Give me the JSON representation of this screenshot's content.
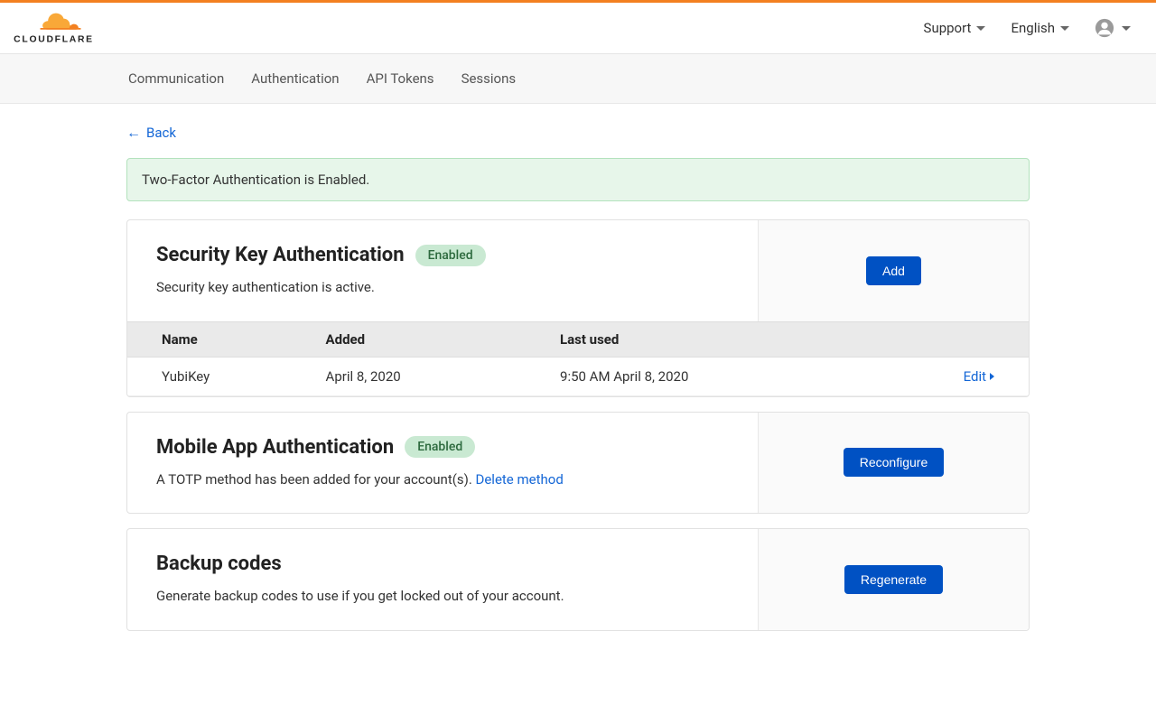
{
  "header": {
    "support_label": "Support",
    "language_label": "English"
  },
  "tabs": [
    {
      "label": "Communication"
    },
    {
      "label": "Authentication"
    },
    {
      "label": "API Tokens"
    },
    {
      "label": "Sessions"
    }
  ],
  "back_label": "Back",
  "alert": {
    "text": "Two-Factor Authentication is Enabled."
  },
  "security_key": {
    "title": "Security Key Authentication",
    "badge": "Enabled",
    "desc": "Security key authentication is active.",
    "button": "Add",
    "columns": {
      "name": "Name",
      "added": "Added",
      "last_used": "Last used"
    },
    "rows": [
      {
        "name": "YubiKey",
        "added": "April 8, 2020",
        "last_used": "9:50 AM April 8, 2020",
        "action": "Edit"
      }
    ]
  },
  "mobile_app": {
    "title": "Mobile App Authentication",
    "badge": "Enabled",
    "desc_prefix": "A TOTP method has been added for your account(s). ",
    "delete_link": "Delete method",
    "button": "Reconfigure"
  },
  "backup_codes": {
    "title": "Backup codes",
    "desc": "Generate backup codes to use if you get locked out of your account.",
    "button": "Regenerate"
  }
}
